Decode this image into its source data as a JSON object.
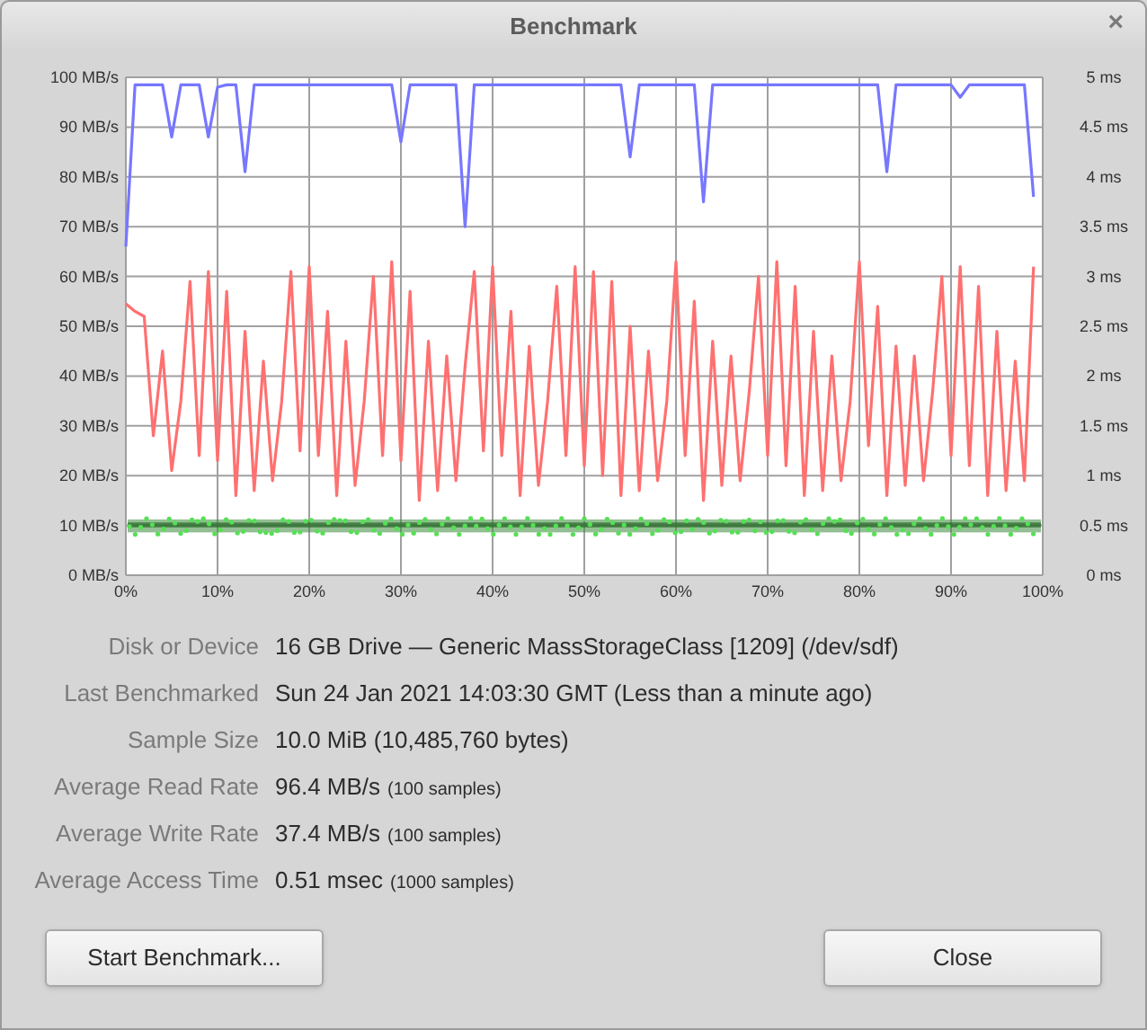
{
  "window": {
    "title": "Benchmark",
    "close_glyph": "×"
  },
  "chart": {
    "right_axis_labels": [
      "5 ms",
      "4.5 ms",
      "4 ms",
      "3.5 ms",
      "3 ms",
      "2.5 ms",
      "2 ms",
      "1.5 ms",
      "1 ms",
      "0.5 ms",
      "0 ms"
    ],
    "chart_data": {
      "type": "line",
      "grid": true,
      "xlim": [
        0,
        100
      ],
      "ylim": [
        0,
        100
      ],
      "x": [
        0,
        1,
        2,
        3,
        4,
        5,
        6,
        7,
        8,
        9,
        10,
        11,
        12,
        13,
        14,
        15,
        16,
        17,
        18,
        19,
        20,
        21,
        22,
        23,
        24,
        25,
        26,
        27,
        28,
        29,
        30,
        31,
        32,
        33,
        34,
        35,
        36,
        37,
        38,
        39,
        40,
        41,
        42,
        43,
        44,
        45,
        46,
        47,
        48,
        49,
        50,
        51,
        52,
        53,
        54,
        55,
        56,
        57,
        58,
        59,
        60,
        61,
        62,
        63,
        64,
        65,
        66,
        67,
        68,
        69,
        70,
        71,
        72,
        73,
        74,
        75,
        76,
        77,
        78,
        79,
        80,
        81,
        82,
        83,
        84,
        85,
        86,
        87,
        88,
        89,
        90,
        91,
        92,
        93,
        94,
        95,
        96,
        97,
        98,
        99
      ],
      "xticks": [
        {
          "value": 0,
          "label": "0%"
        },
        {
          "value": 10,
          "label": "10%"
        },
        {
          "value": 20,
          "label": "20%"
        },
        {
          "value": 30,
          "label": "30%"
        },
        {
          "value": 40,
          "label": "40%"
        },
        {
          "value": 50,
          "label": "50%"
        },
        {
          "value": 60,
          "label": "60%"
        },
        {
          "value": 70,
          "label": "70%"
        },
        {
          "value": 80,
          "label": "80%"
        },
        {
          "value": 90,
          "label": "90%"
        },
        {
          "value": 100,
          "label": "100%"
        }
      ],
      "yticks": [
        {
          "value": 100,
          "label": "100 MB/s"
        },
        {
          "value": 90,
          "label": "90 MB/s"
        },
        {
          "value": 80,
          "label": "80 MB/s"
        },
        {
          "value": 70,
          "label": "70 MB/s"
        },
        {
          "value": 60,
          "label": "60 MB/s"
        },
        {
          "value": 50,
          "label": "50 MB/s"
        },
        {
          "value": 40,
          "label": "40 MB/s"
        },
        {
          "value": 30,
          "label": "30 MB/s"
        },
        {
          "value": 20,
          "label": "20 MB/s"
        },
        {
          "value": 10,
          "label": "10 MB/s"
        },
        {
          "value": 0,
          "label": "0 MB/s"
        }
      ],
      "series": [
        {
          "color": "#7777ff",
          "values": [
            66,
            98.5,
            98.5,
            98.5,
            98.5,
            88,
            98.5,
            98.5,
            98.5,
            88,
            98,
            98.5,
            98.5,
            81,
            98.5,
            98.5,
            98.5,
            98.5,
            98.5,
            98.5,
            98.5,
            98.5,
            98.5,
            98.5,
            98.5,
            98.5,
            98.5,
            98.5,
            98.5,
            98.5,
            87,
            98.5,
            98.5,
            98.5,
            98.5,
            98.5,
            98.5,
            70,
            98.5,
            98.5,
            98.5,
            98.5,
            98.5,
            98.5,
            98.5,
            98.5,
            98.5,
            98.5,
            98.5,
            98.5,
            98.5,
            98.5,
            98.5,
            98.5,
            98.5,
            84,
            98.5,
            98.5,
            98.5,
            98.5,
            98.5,
            98.5,
            98.5,
            75,
            98.5,
            98.5,
            98.5,
            98.5,
            98.5,
            98.5,
            98.5,
            98.5,
            98.5,
            98.5,
            98.5,
            98.5,
            98.5,
            98.5,
            98.5,
            98.5,
            98.5,
            98.5,
            98.5,
            81,
            98.5,
            98.5,
            98.5,
            98.5,
            98.5,
            98.5,
            98.5,
            96,
            98.5,
            98.5,
            98.5,
            98.5,
            98.5,
            98.5,
            98.5,
            76
          ]
        },
        {
          "color": "#ff7070",
          "values": [
            54.5,
            53,
            52,
            28,
            45,
            21,
            35,
            59,
            24,
            61,
            23,
            57,
            16,
            49,
            17,
            43,
            19,
            35,
            61,
            25,
            62,
            24,
            53,
            16,
            47,
            18,
            35,
            60,
            24,
            63,
            23,
            57,
            15,
            47,
            17,
            44,
            19,
            42,
            61,
            25,
            62,
            24,
            53,
            16,
            46,
            18,
            35,
            58,
            24,
            62,
            22,
            61,
            20,
            59,
            16,
            50,
            17,
            45,
            19,
            35,
            63,
            24,
            55,
            15,
            47,
            18,
            44,
            19,
            37,
            60,
            24,
            63,
            22,
            58,
            16,
            49,
            17,
            44,
            19,
            35,
            63,
            26,
            54,
            16,
            46,
            18,
            44,
            19,
            37,
            60,
            24,
            62,
            22,
            58,
            16,
            49,
            17,
            43,
            19,
            62
          ]
        }
      ]
    }
  },
  "details": [
    {
      "label": "Disk or Device",
      "value": "16 GB Drive — Generic MassStorageClass [1209] (/dev/sdf)"
    },
    {
      "label": "Last Benchmarked",
      "value": "Sun 24 Jan 2021 14:03:30 GMT (Less than a minute ago)"
    },
    {
      "label": "Sample Size",
      "value": "10.0 MiB (10,485,760 bytes)"
    },
    {
      "label": "Average Read Rate",
      "value": "96.4 MB/s",
      "note": "(100 samples)"
    },
    {
      "label": "Average Write Rate",
      "value": "37.4 MB/s",
      "note": "(100 samples)"
    },
    {
      "label": "Average Access Time",
      "value": "0.51 msec",
      "note": "(1000 samples)"
    }
  ],
  "buttons": [
    {
      "label": "Start Benchmark..."
    },
    {
      "label": "Close"
    }
  ]
}
